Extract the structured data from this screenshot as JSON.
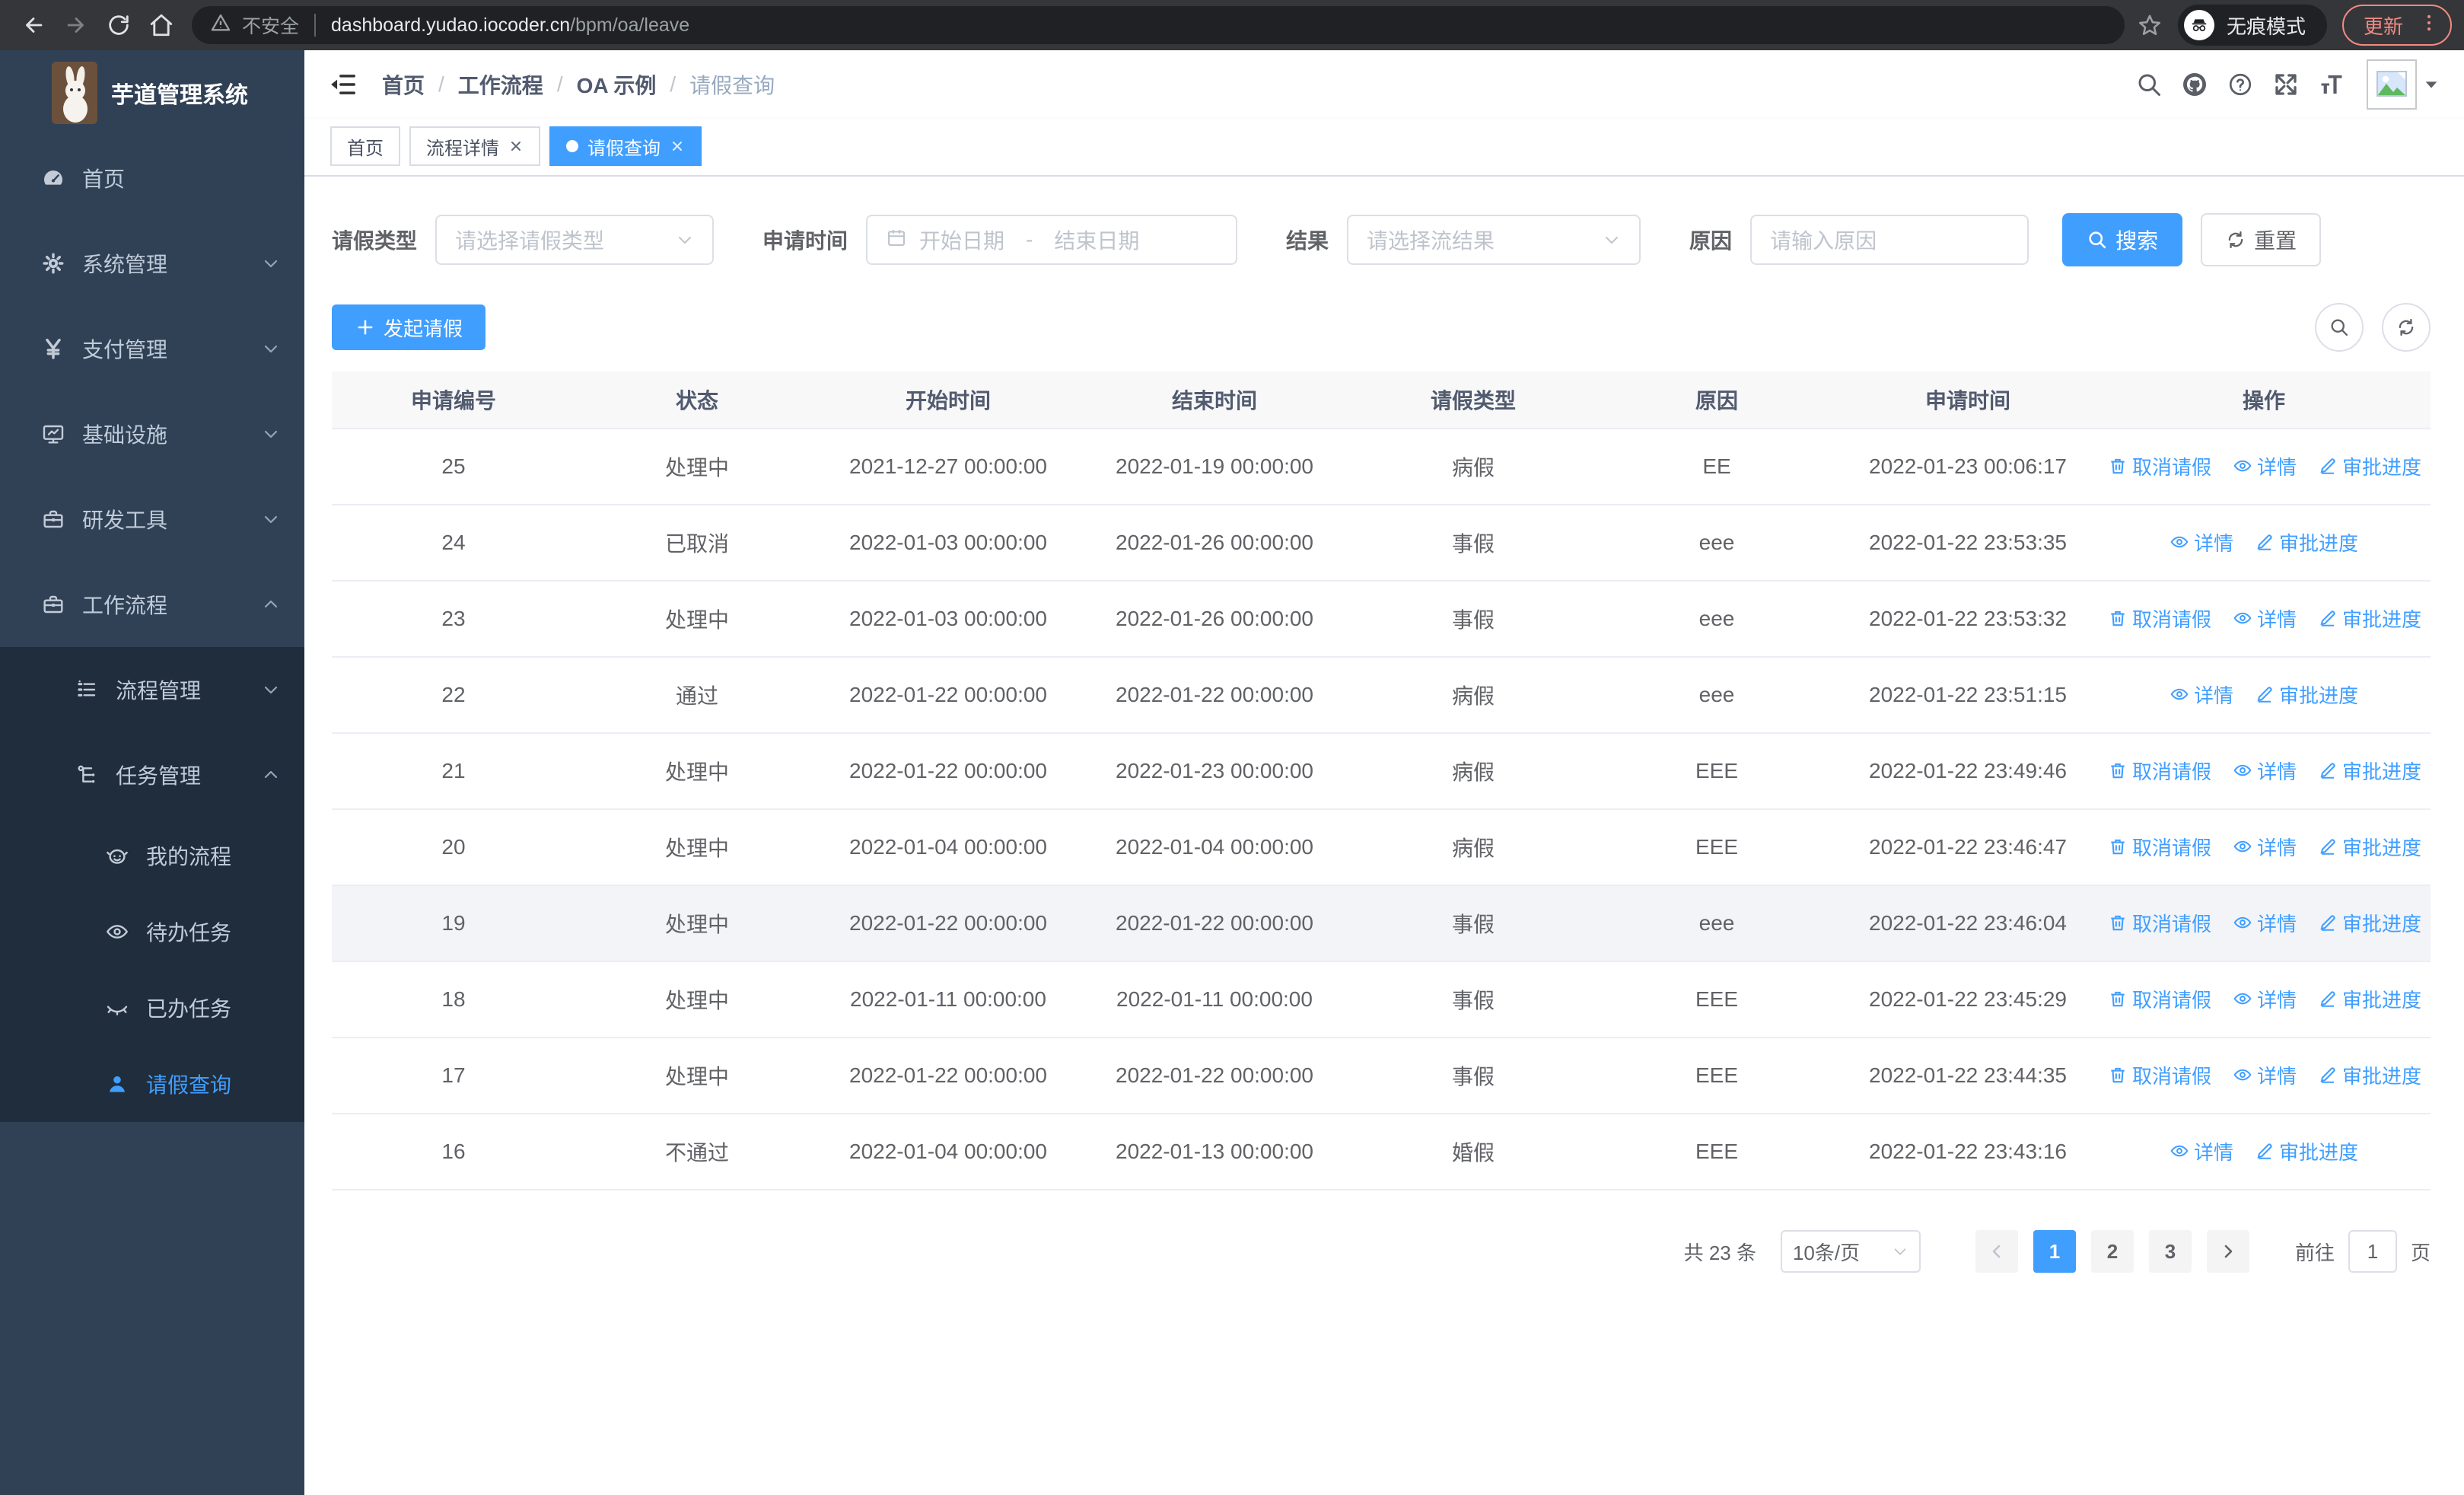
{
  "browser": {
    "security_label": "不安全",
    "url_host": "dashboard.yudao.iocoder.cn",
    "url_path": "/bpm/oa/leave",
    "incognito_label": "无痕模式",
    "update_label": "更新"
  },
  "header": {
    "app_title": "芋道管理系统",
    "breadcrumb": [
      "首页",
      "工作流程",
      "OA 示例",
      "请假查询"
    ]
  },
  "tabs": [
    {
      "label": "首页"
    },
    {
      "label": "流程详情"
    },
    {
      "label": "请假查询"
    }
  ],
  "sidebar": {
    "items": [
      {
        "label": "首页"
      },
      {
        "label": "系统管理"
      },
      {
        "label": "支付管理"
      },
      {
        "label": "基础设施"
      },
      {
        "label": "研发工具"
      },
      {
        "label": "工作流程"
      },
      {
        "label": "流程管理"
      },
      {
        "label": "任务管理"
      },
      {
        "label": "我的流程"
      },
      {
        "label": "待办任务"
      },
      {
        "label": "已办任务"
      },
      {
        "label": "请假查询"
      }
    ]
  },
  "filter": {
    "type_label": "请假类型",
    "type_placeholder": "请选择请假类型",
    "time_label": "申请时间",
    "date_start_placeholder": "开始日期",
    "date_separator": "-",
    "date_end_placeholder": "结束日期",
    "result_label": "结果",
    "result_placeholder": "请选择流结果",
    "reason_label": "原因",
    "reason_placeholder": "请输入原因",
    "search_label": "搜索",
    "reset_label": "重置"
  },
  "toolbar": {
    "create_label": "发起请假"
  },
  "table": {
    "headers": [
      "申请编号",
      "状态",
      "开始时间",
      "结束时间",
      "请假类型",
      "原因",
      "申请时间",
      "操作"
    ],
    "action_labels": {
      "cancel": "取消请假",
      "detail": "详情",
      "progress": "审批进度"
    },
    "rows": [
      {
        "id": "25",
        "status": "处理中",
        "start": "2021-12-27 00:00:00",
        "end": "2022-01-19 00:00:00",
        "type": "病假",
        "reason": "EE",
        "applyTime": "2022-01-23 00:06:17",
        "actions": [
          "cancel",
          "detail",
          "progress"
        ],
        "highlight": false
      },
      {
        "id": "24",
        "status": "已取消",
        "start": "2022-01-03 00:00:00",
        "end": "2022-01-26 00:00:00",
        "type": "事假",
        "reason": "eee",
        "applyTime": "2022-01-22 23:53:35",
        "actions": [
          "detail",
          "progress"
        ],
        "highlight": false
      },
      {
        "id": "23",
        "status": "处理中",
        "start": "2022-01-03 00:00:00",
        "end": "2022-01-26 00:00:00",
        "type": "事假",
        "reason": "eee",
        "applyTime": "2022-01-22 23:53:32",
        "actions": [
          "cancel",
          "detail",
          "progress"
        ],
        "highlight": false
      },
      {
        "id": "22",
        "status": "通过",
        "start": "2022-01-22 00:00:00",
        "end": "2022-01-22 00:00:00",
        "type": "病假",
        "reason": "eee",
        "applyTime": "2022-01-22 23:51:15",
        "actions": [
          "detail",
          "progress"
        ],
        "highlight": false
      },
      {
        "id": "21",
        "status": "处理中",
        "start": "2022-01-22 00:00:00",
        "end": "2022-01-23 00:00:00",
        "type": "病假",
        "reason": "EEE",
        "applyTime": "2022-01-22 23:49:46",
        "actions": [
          "cancel",
          "detail",
          "progress"
        ],
        "highlight": false
      },
      {
        "id": "20",
        "status": "处理中",
        "start": "2022-01-04 00:00:00",
        "end": "2022-01-04 00:00:00",
        "type": "病假",
        "reason": "EEE",
        "applyTime": "2022-01-22 23:46:47",
        "actions": [
          "cancel",
          "detail",
          "progress"
        ],
        "highlight": false
      },
      {
        "id": "19",
        "status": "处理中",
        "start": "2022-01-22 00:00:00",
        "end": "2022-01-22 00:00:00",
        "type": "事假",
        "reason": "eee",
        "applyTime": "2022-01-22 23:46:04",
        "actions": [
          "cancel",
          "detail",
          "progress"
        ],
        "highlight": true
      },
      {
        "id": "18",
        "status": "处理中",
        "start": "2022-01-11 00:00:00",
        "end": "2022-01-11 00:00:00",
        "type": "事假",
        "reason": "EEE",
        "applyTime": "2022-01-22 23:45:29",
        "actions": [
          "cancel",
          "detail",
          "progress"
        ],
        "highlight": false
      },
      {
        "id": "17",
        "status": "处理中",
        "start": "2022-01-22 00:00:00",
        "end": "2022-01-22 00:00:00",
        "type": "事假",
        "reason": "EEE",
        "applyTime": "2022-01-22 23:44:35",
        "actions": [
          "cancel",
          "detail",
          "progress"
        ],
        "highlight": false
      },
      {
        "id": "16",
        "status": "不通过",
        "start": "2022-01-04 00:00:00",
        "end": "2022-01-13 00:00:00",
        "type": "婚假",
        "reason": "EEE",
        "applyTime": "2022-01-22 23:43:16",
        "actions": [
          "detail",
          "progress"
        ],
        "highlight": false
      }
    ]
  },
  "pagination": {
    "total_label": "共 23 条",
    "page_size": "10条/页",
    "pages": [
      "1",
      "2",
      "3"
    ],
    "active_page": "1",
    "goto_label": "前往",
    "goto_value": "1",
    "page_suffix": "页"
  },
  "colors": {
    "primary": "#409eff",
    "sidebar_bg": "#304156",
    "sidebar_submenu_bg": "#1f2d3d",
    "update_accent": "#f28b82"
  }
}
